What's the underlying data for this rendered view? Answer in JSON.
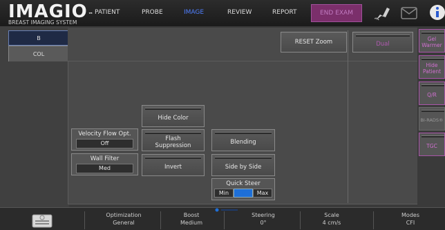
{
  "header": {
    "logo": "IMAGIO",
    "logo_tm": "™",
    "logo_sub": "BREAST IMAGING SYSTEM",
    "nav": [
      {
        "label": "PATIENT",
        "active": false
      },
      {
        "label": "PROBE",
        "active": false
      },
      {
        "label": "IMAGE",
        "active": true
      },
      {
        "label": "REVIEW",
        "active": false
      },
      {
        "label": "REPORT",
        "active": false
      }
    ],
    "end_exam": "END EXAM"
  },
  "mode_tabs": {
    "b": "B",
    "col": "COL"
  },
  "controls": {
    "reset_zoom": "RESET Zoom",
    "dual": "Dual",
    "hide_color": "Hide Color",
    "velocity_label": "Velocity Flow Opt.",
    "velocity_value": "Off",
    "flash_suppression": "Flash Suppression",
    "blending": "Blending",
    "wall_filter_label": "Wall Filter",
    "wall_filter_value": "Med",
    "invert": "Invert",
    "side_by_side": "Side by Side",
    "quick_steer_label": "Quick Steer",
    "quick_steer_min": "Min",
    "quick_steer_mid": "0",
    "quick_steer_max": "Max"
  },
  "right_buttons": [
    "Gel Warmer",
    "Hide Patient",
    "Q/R",
    "BI-RADS®",
    "TGC"
  ],
  "bottom": {
    "items": [
      {
        "label": "Optimization",
        "value": "General"
      },
      {
        "label": "Boost",
        "value": "Medium"
      },
      {
        "label": "Steering",
        "value": "0°"
      },
      {
        "label": "Scale",
        "value": "4 cm/s"
      },
      {
        "label": "Modes",
        "value": "CFI"
      }
    ]
  },
  "colors": {
    "accent": "#4f7fff",
    "end_exam": "#7b2f6b",
    "right_button_text": "#d070d0"
  }
}
